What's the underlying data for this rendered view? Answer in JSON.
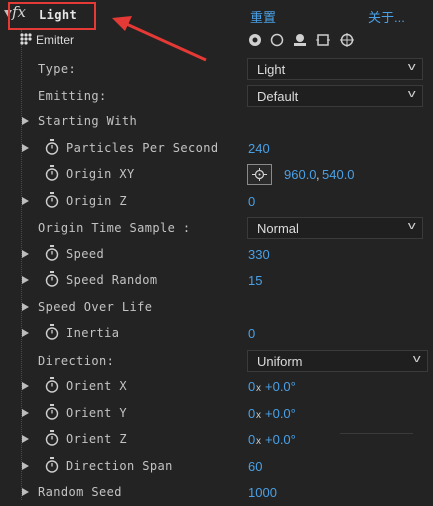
{
  "effect": {
    "fx_glyph": "fx",
    "name": "Light",
    "reset_label": "重置",
    "about_label": "关于..."
  },
  "emitter": {
    "label": "Emitter",
    "icons": [
      "record-circle-icon",
      "circle-icon",
      "emitter-shape-icon",
      "square-target-icon",
      "crosshair-icon"
    ]
  },
  "rows": {
    "type": {
      "label": "Type:",
      "value": "Light"
    },
    "emitting": {
      "label": "Emitting:",
      "value": "Default"
    },
    "starting_with": {
      "label": "Starting With"
    },
    "particles_per_second": {
      "label": "Particles Per Second",
      "value": "240"
    },
    "origin_xy": {
      "label": "Origin XY",
      "x": "960.0",
      "y": "540.0"
    },
    "origin_z": {
      "label": "Origin Z",
      "value": "0"
    },
    "origin_time_sample": {
      "label": "Origin Time Sample :",
      "value": "Normal"
    },
    "speed": {
      "label": "Speed",
      "value": "330"
    },
    "speed_random": {
      "label": "Speed Random",
      "value": "15"
    },
    "speed_over_life": {
      "label": "Speed Over Life"
    },
    "inertia": {
      "label": "Inertia",
      "value": "0"
    },
    "direction": {
      "label": "Direction:",
      "value": "Uniform"
    },
    "orient_x": {
      "label": "Orient X",
      "rev": "0",
      "x": "x",
      "deg": "+0.0°"
    },
    "orient_y": {
      "label": "Orient Y",
      "rev": "0",
      "x": "x",
      "deg": "+0.0°"
    },
    "orient_z": {
      "label": "Orient Z",
      "rev": "0",
      "x": "x",
      "deg": "+0.0°"
    },
    "direction_span": {
      "label": "Direction Span",
      "value": "60"
    },
    "random_seed": {
      "label": "Random Seed",
      "value": "1000"
    }
  },
  "colors": {
    "accent": "#4aa0e6",
    "annotation_red": "#e53935",
    "background": "#232323"
  }
}
